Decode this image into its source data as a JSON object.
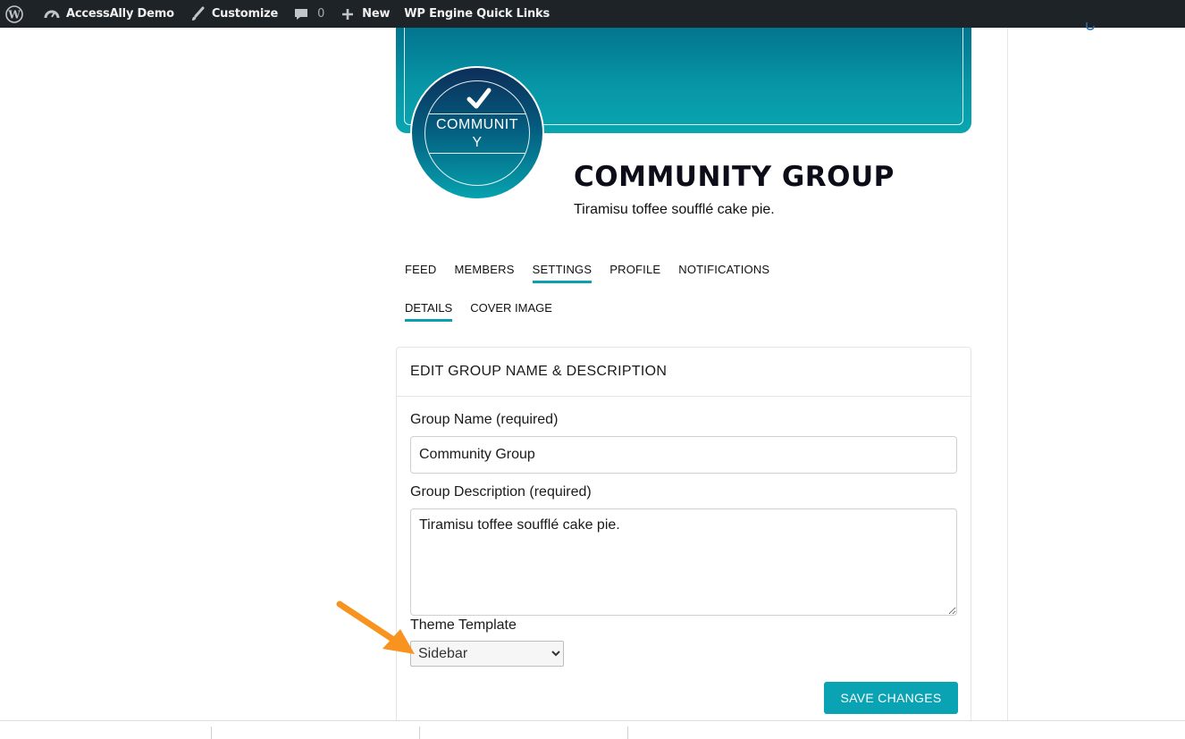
{
  "adminbar": {
    "site_name": "AccessAlly Demo",
    "customize": "Customize",
    "comments_count": "0",
    "new_label": "New",
    "quick_links": "WP Engine Quick Links"
  },
  "group": {
    "avatar_text": "COMMUNITY",
    "title": "COMMUNITY GROUP",
    "description": "Tiramisu toffee soufflé cake pie."
  },
  "tabs": [
    {
      "label": "FEED"
    },
    {
      "label": "MEMBERS"
    },
    {
      "label": "SETTINGS"
    },
    {
      "label": "PROFILE"
    },
    {
      "label": "NOTIFICATIONS"
    }
  ],
  "subtabs": [
    {
      "label": "DETAILS"
    },
    {
      "label": "COVER IMAGE"
    }
  ],
  "form": {
    "heading": "EDIT GROUP NAME & DESCRIPTION",
    "name_label": "Group Name (required)",
    "name_value": "Community Group",
    "desc_label": "Group Description (required)",
    "desc_value": "Tiramisu toffee soufflé cake pie.",
    "theme_label": "Theme Template",
    "theme_selected": "Sidebar",
    "save_label": "SAVE CHANGES"
  },
  "colors": {
    "accent": "#09a3b3",
    "adminbar": "#1d2327",
    "arrow": "#f7931e"
  }
}
